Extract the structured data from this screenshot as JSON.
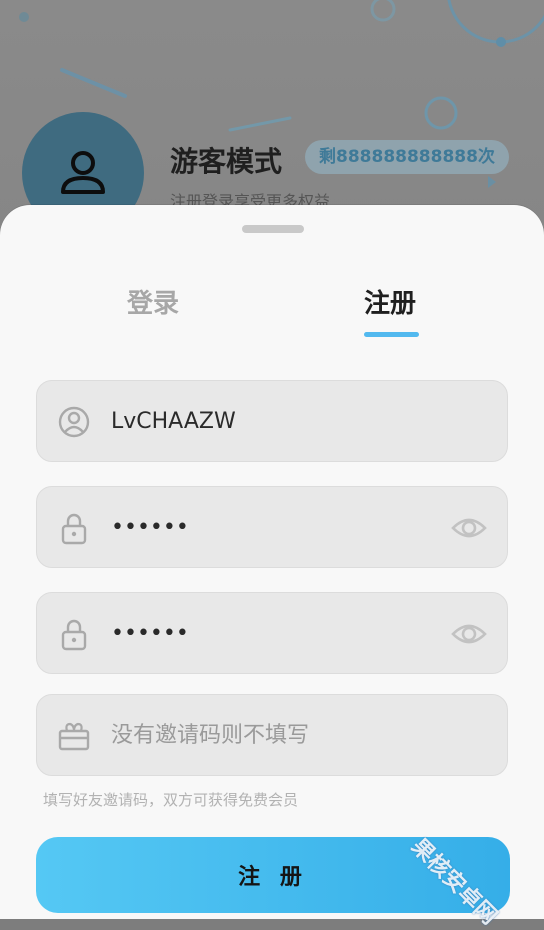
{
  "header": {
    "title": "游客模式",
    "remaining_badge": "剩888888888888次",
    "subtitle": "注册登录享受更多权益",
    "avatar_icon": "user-icon"
  },
  "tabs": [
    {
      "label": "登录",
      "active": false
    },
    {
      "label": "注册",
      "active": true
    }
  ],
  "form": {
    "username": {
      "value": "LvCHAAZW",
      "icon": "user-circle-icon"
    },
    "password": {
      "value": "••••••",
      "icon": "lock-icon",
      "toggle_icon": "eye-icon"
    },
    "confirm_password": {
      "value": "••••••",
      "icon": "lock-icon",
      "toggle_icon": "eye-icon"
    },
    "invite_code": {
      "value": "",
      "placeholder": "没有邀请码则不填写",
      "icon": "gift-icon"
    },
    "hint": "填写好友邀请码，双方可获得免费会员"
  },
  "register_button": "注 册",
  "watermark": "果核安卓网",
  "colors": {
    "accent": "#52b9ef",
    "button_start": "#55c8f4",
    "button_end": "#35aee8",
    "field_bg": "#e8e8e8",
    "sheet_bg": "#f8f8f8"
  }
}
